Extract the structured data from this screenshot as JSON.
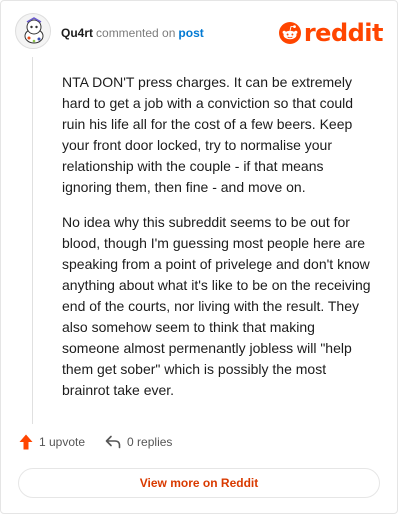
{
  "header": {
    "username": "Qu4rt",
    "commented_text": "commented on",
    "post_link": "post",
    "logo_text": "reddit"
  },
  "comment": {
    "paragraphs": [
      "NTA DON'T press charges. It can be extremely hard to get a job with a conviction so that could ruin his life all for the cost of a few beers. Keep your front door locked, try to normalise your relationship with the couple - if that means ignoring them, then fine - and move on.",
      "No idea why this subreddit seems to be out for blood, though I'm guessing most people here are speaking from a point of privelege and don't know anything about what it's like to be on the receiving end of the courts, nor living with the result. They also somehow seem to think that making someone almost permenantly jobless will \"help them get sober\" which is possibly the most brainrot take ever."
    ]
  },
  "actions": {
    "upvote_label": "1 upvote",
    "replies_label": "0 replies"
  },
  "footer": {
    "view_more_label": "View more on Reddit"
  },
  "colors": {
    "brand": "#ff4500",
    "link": "#0079d3",
    "view_more": "#d93a00"
  },
  "icons": {
    "logo": "reddit-snoo-icon",
    "upvote": "upvote-arrow-icon",
    "reply": "reply-arrow-icon"
  }
}
